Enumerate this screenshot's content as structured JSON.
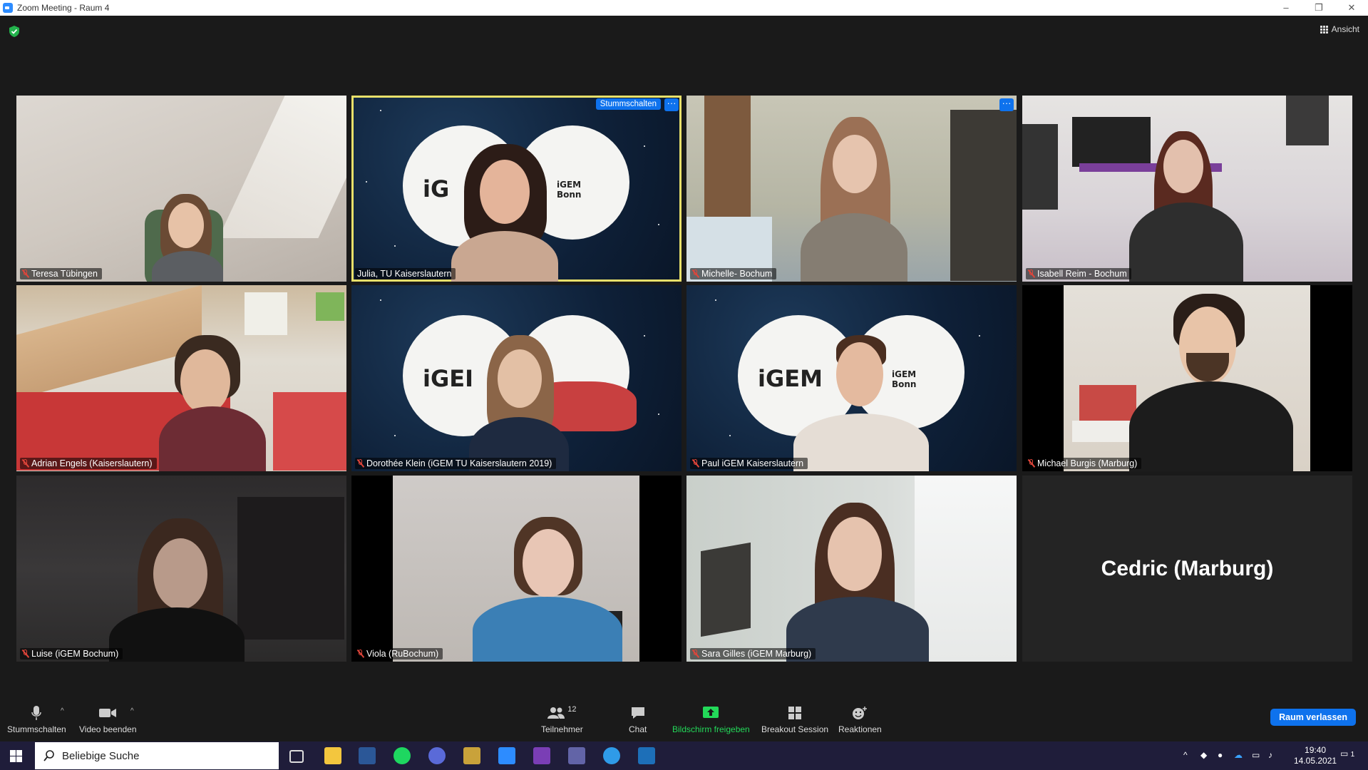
{
  "window": {
    "title": "Zoom Meeting - Raum 4",
    "minimize": "–",
    "restore": "❐",
    "close": "✕"
  },
  "view_button": {
    "label": "Ansicht"
  },
  "tiles": [
    {
      "name": "Teresa Tübingen",
      "muted": true
    },
    {
      "name": "Julia, TU Kaiserslautern",
      "muted": false,
      "active": true
    },
    {
      "name": "Michelle- Bochum",
      "muted": true
    },
    {
      "name": "Isabell Reim - Bochum",
      "muted": true
    },
    {
      "name": "Adrian Engels (Kaiserslautern)",
      "muted": true
    },
    {
      "name": "Dorothée Klein (iGEM TU Kaiserslautern 2019)",
      "muted": true
    },
    {
      "name": "Paul iGEM Kaiserslautern",
      "muted": true
    },
    {
      "name": "Michael Burgis (Marburg)",
      "muted": true
    },
    {
      "name": "Luise (iGEM Bochum)",
      "muted": true
    },
    {
      "name": "Viola (RuBochum)",
      "muted": true
    },
    {
      "name": "Sara Gilles (iGEM Marburg)",
      "muted": true
    },
    {
      "name": "Cedric (Marburg)",
      "muted": false
    }
  ],
  "tile_overlay": {
    "mute_button": "Stummschalten",
    "more_button": "···"
  },
  "toolbar": {
    "mute": "Stummschalten",
    "video": "Video beenden",
    "participants": "Teilnehmer",
    "participants_count": "12",
    "chat": "Chat",
    "share": "Bildschirm freigeben",
    "breakout": "Breakout Session",
    "reactions": "Reaktionen",
    "leave": "Raum verlassen"
  },
  "taskbar": {
    "search_placeholder": "Beliebige Suche",
    "time": "19:40",
    "date": "14.05.2021",
    "notification_count": "1"
  },
  "colors": {
    "accent": "#0e72ed",
    "share_green": "#23d959",
    "muted_red": "#e0453a",
    "active_border": "#e8e06a"
  }
}
